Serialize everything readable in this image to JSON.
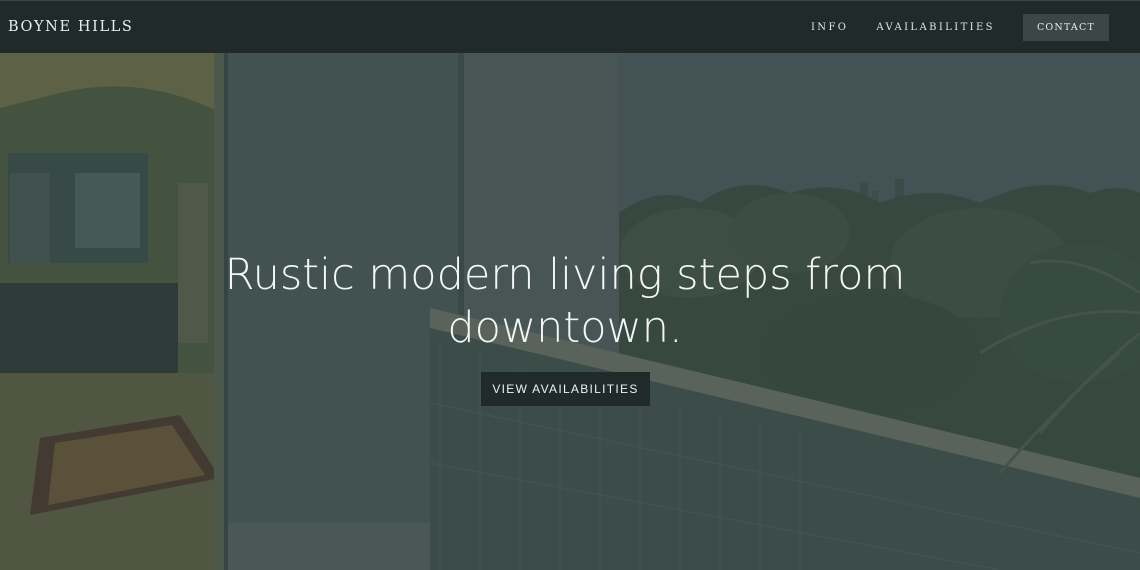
{
  "nav": {
    "brand": "BOYNE HILLS",
    "links": [
      {
        "label": "INFO"
      },
      {
        "label": "AVAILABILITIES"
      }
    ],
    "contact_label": "CONTACT"
  },
  "hero": {
    "headline": "Rustic modern living steps from downtown.",
    "cta_label": "VIEW AVAILABILITIES"
  },
  "colors": {
    "nav_background": "#1f2a29",
    "contact_button": "#3b4645",
    "cta_background": "#1f2a29",
    "hero_tint": "#2e3d3c"
  }
}
